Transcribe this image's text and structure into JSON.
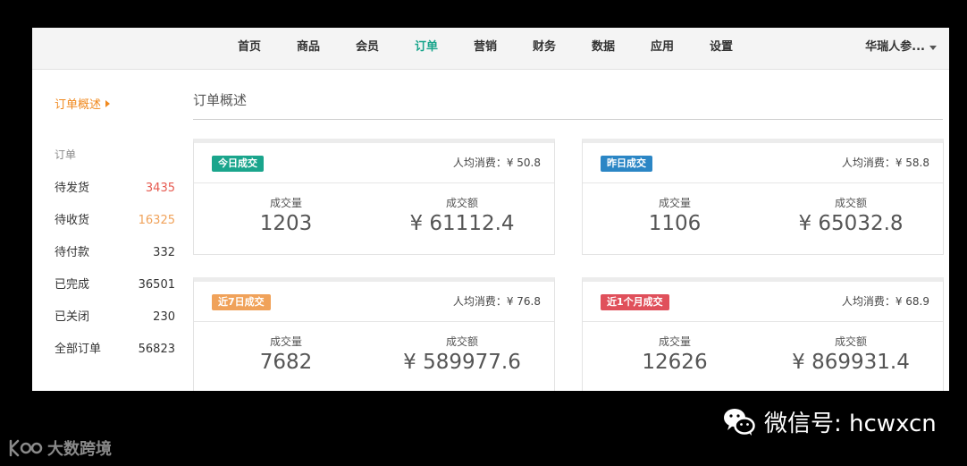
{
  "nav": {
    "items": [
      "首页",
      "商品",
      "会员",
      "订单",
      "营销",
      "财务",
      "数据",
      "应用",
      "设置"
    ],
    "active": "订单",
    "user": "华瑞人参..."
  },
  "sidebar": {
    "overview": "订单概述",
    "group": "订单",
    "items": [
      {
        "label": "待发货",
        "count": "3435"
      },
      {
        "label": "待收货",
        "count": "16325"
      },
      {
        "label": "待付款",
        "count": "332"
      },
      {
        "label": "已完成",
        "count": "36501"
      },
      {
        "label": "已关闭",
        "count": "230"
      },
      {
        "label": "全部订单",
        "count": "56823"
      }
    ]
  },
  "page_title": "订单概述",
  "cards": [
    {
      "badge": "今日成交",
      "badge_color": "#1aa58c",
      "avg": "人均消费：¥ 50.8",
      "qty_label": "成交量",
      "qty": "1203",
      "amt_label": "成交额",
      "amt": "¥ 61112.4"
    },
    {
      "badge": "昨日成交",
      "badge_color": "#2b86c5",
      "avg": "人均消费：¥ 58.8",
      "qty_label": "成交量",
      "qty": "1106",
      "amt_label": "成交额",
      "amt": "¥ 65032.8"
    },
    {
      "badge": "近7日成交",
      "badge_color": "#f0a25a",
      "avg": "人均消费：¥ 76.8",
      "qty_label": "成交量",
      "qty": "7682",
      "amt_label": "成交额",
      "amt": "¥ 589977.6"
    },
    {
      "badge": "近1个月成交",
      "badge_color": "#e0505b",
      "avg": "人均消费：¥ 68.9",
      "qty_label": "成交量",
      "qty": "12626",
      "amt_label": "成交额",
      "amt": "¥ 869931.4"
    }
  ],
  "watermark": {
    "wechat": "微信号: hcwxcn",
    "brand": "大数跨境"
  }
}
